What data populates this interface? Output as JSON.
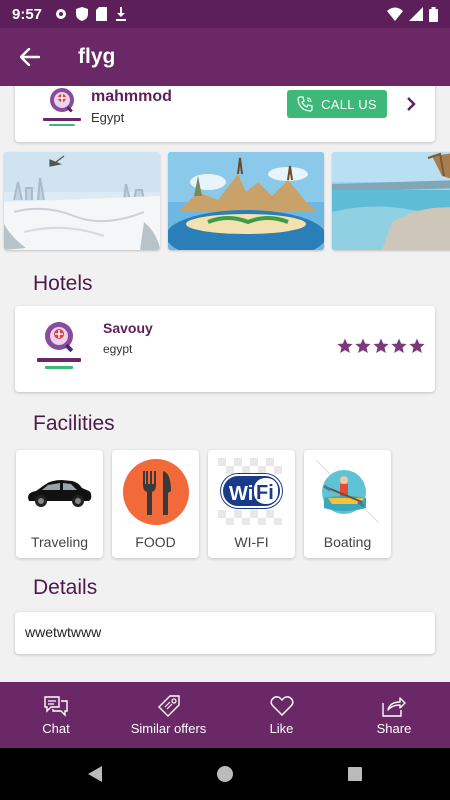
{
  "status_bar": {
    "time": "9:57"
  },
  "app_bar": {
    "title": "flyg"
  },
  "agent": {
    "name": "mahmmod",
    "country": "Egypt",
    "call_label": "CALL US"
  },
  "sections": {
    "hotels": "Hotels",
    "facilities": "Facilities",
    "details": "Details"
  },
  "hotel": {
    "name": "Savouy",
    "country": "egypt",
    "rating": 5
  },
  "facilities": [
    {
      "label": "Traveling",
      "icon": "car-icon"
    },
    {
      "label": "FOOD",
      "icon": "fork-knife-icon"
    },
    {
      "label": "WI-FI",
      "icon": "wifi-icon"
    },
    {
      "label": "Boating",
      "icon": "boat-icon"
    }
  ],
  "details": {
    "text": "wwetwtwww"
  },
  "bottom_nav": [
    {
      "label": "Chat",
      "icon": "chat-icon"
    },
    {
      "label": "Similar offers",
      "icon": "tag-icon"
    },
    {
      "label": "Like",
      "icon": "heart-icon"
    },
    {
      "label": "Share",
      "icon": "share-icon"
    }
  ],
  "colors": {
    "primary": "#6a2866",
    "status": "#5d1f5a",
    "call": "#3cb878",
    "star": "#7a3a7a",
    "food": "#f26a3a"
  }
}
